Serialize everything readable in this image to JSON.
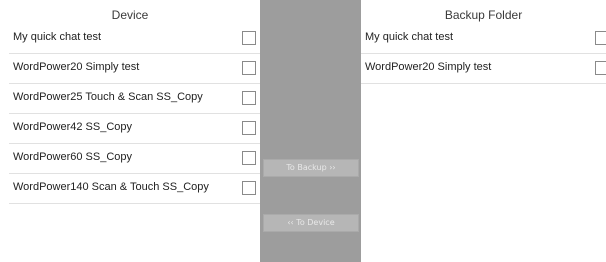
{
  "device_panel": {
    "title": "Device",
    "items": [
      {
        "label": "My quick chat test",
        "checked": false
      },
      {
        "label": "WordPower20 Simply test",
        "checked": false
      },
      {
        "label": "WordPower25 Touch & Scan SS_Copy",
        "checked": false
      },
      {
        "label": "WordPower42 SS_Copy",
        "checked": false
      },
      {
        "label": "WordPower60 SS_Copy",
        "checked": false
      },
      {
        "label": "WordPower140 Scan & Touch SS_Copy",
        "checked": false
      }
    ]
  },
  "transfer": {
    "to_backup_label": "To Backup ››",
    "to_device_label": "‹‹ To Device"
  },
  "backup_panel": {
    "title": "Backup Folder",
    "items": [
      {
        "label": "My quick chat test",
        "checked": false
      },
      {
        "label": "WordPower20 Simply test",
        "checked": false
      }
    ]
  },
  "colors": {
    "middle_background": "#9d9d9d",
    "button_background": "#b6b6b6",
    "divider": "#e1e1e1"
  }
}
